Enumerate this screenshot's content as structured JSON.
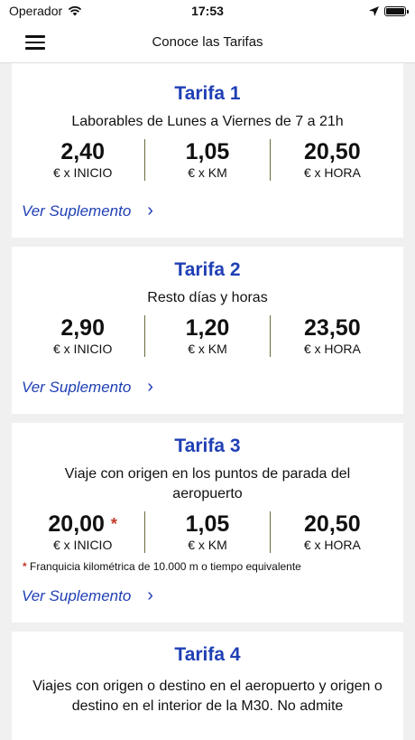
{
  "status": {
    "carrier": "Operador",
    "time": "17:53"
  },
  "nav": {
    "title": "Conoce las Tarifas"
  },
  "tarifas": [
    {
      "title": "Tarifa 1",
      "subtitle": "Laborables de Lunes a Viernes de 7 a 21h",
      "prices": [
        {
          "value": "2,40",
          "unit": "€ x INICIO"
        },
        {
          "value": "1,05",
          "unit": "€ x KM"
        },
        {
          "value": "20,50",
          "unit": "€ x HORA"
        }
      ],
      "link": "Ver Suplemento"
    },
    {
      "title": "Tarifa 2",
      "subtitle": "Resto días y horas",
      "prices": [
        {
          "value": "2,90",
          "unit": "€ x INICIO"
        },
        {
          "value": "1,20",
          "unit": "€ x KM"
        },
        {
          "value": "23,50",
          "unit": "€ x HORA"
        }
      ],
      "link": "Ver Suplemento"
    },
    {
      "title": "Tarifa 3",
      "subtitle": "Viaje con origen en los puntos de parada del aeropuerto",
      "prices": [
        {
          "value": "20,00",
          "unit": "€ x INICIO"
        },
        {
          "value": "1,05",
          "unit": "€ x KM"
        },
        {
          "value": "20,50",
          "unit": "€ x HORA"
        }
      ],
      "asterisk": "*",
      "note": "Franquicia kilométrica de 10.000 m o tiempo equivalente",
      "link": "Ver Suplemento"
    },
    {
      "title": "Tarifa 4",
      "subtitle": "Viajes con origen o destino en el aeropuerto y  origen o destino en el interior de la M30. No admite"
    }
  ],
  "chevron": "›"
}
